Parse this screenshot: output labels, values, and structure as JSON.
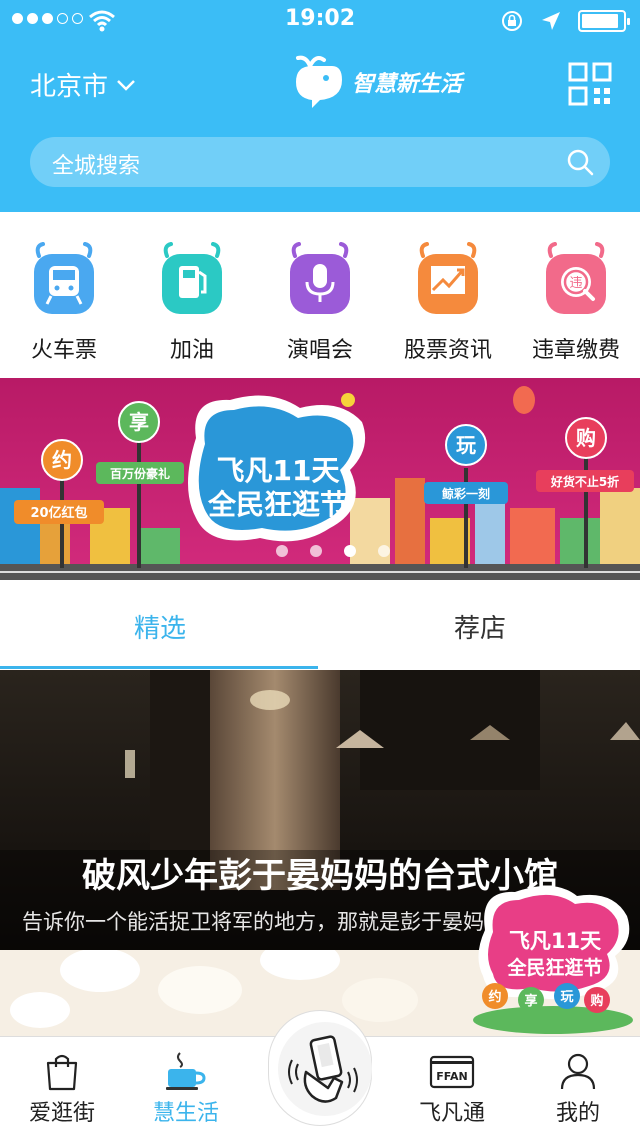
{
  "status_bar": {
    "time": "19:02",
    "signal_bars": 3,
    "signal_total": 5,
    "battery_level": 0.9
  },
  "header": {
    "city": "北京市",
    "logo_text": "智慧新生活",
    "search_placeholder": "全城搜索",
    "background_color": "#3bbdf6"
  },
  "services": [
    {
      "label": "火车票",
      "icon": "train-icon",
      "color": "#4aa8f0"
    },
    {
      "label": "加油",
      "icon": "fuel-icon",
      "color": "#2bc9c4"
    },
    {
      "label": "演唱会",
      "icon": "microphone-icon",
      "color": "#9b5bd8"
    },
    {
      "label": "股票资讯",
      "icon": "stock-chart-icon",
      "color": "#f58a3d"
    },
    {
      "label": "违章缴费",
      "icon": "violation-icon",
      "color": "#f26a8a"
    }
  ],
  "banner": {
    "headline_line1": "飞凡11天",
    "headline_line2": "全民狂逛节",
    "sign_yue": "约",
    "sign_xiang": "享",
    "sign_wan": "玩",
    "sign_gou": "购",
    "caption_yue": "20亿红包",
    "caption_xiang": "百万份豪礼",
    "caption_wan": "鲸彩一刻",
    "caption_gou": "好货不止5折",
    "page_count": 4,
    "active_page": 3
  },
  "tabs": {
    "selected": "精选",
    "other": "荐店"
  },
  "feature": {
    "title": "破风少年彭于晏妈妈的台式小馆",
    "subtitle": "告诉你一个能活捉卫将军的地方，那就是彭于晏妈妈..."
  },
  "float_promo": {
    "line1": "飞凡11天",
    "line2": "全民狂逛节",
    "tags": [
      "约",
      "享",
      "玩",
      "购"
    ]
  },
  "tabbar": {
    "items": [
      {
        "label": "爱逛街",
        "icon": "shopping-bag-icon"
      },
      {
        "label": "慧生活",
        "icon": "coffee-cup-icon"
      },
      {
        "label": "飞凡通",
        "icon": "ffan-card-icon"
      },
      {
        "label": "我的",
        "icon": "user-icon"
      }
    ],
    "active_index": 1,
    "center_icon": "hand-phone-icon",
    "ffan_card_text": "FFAN"
  }
}
